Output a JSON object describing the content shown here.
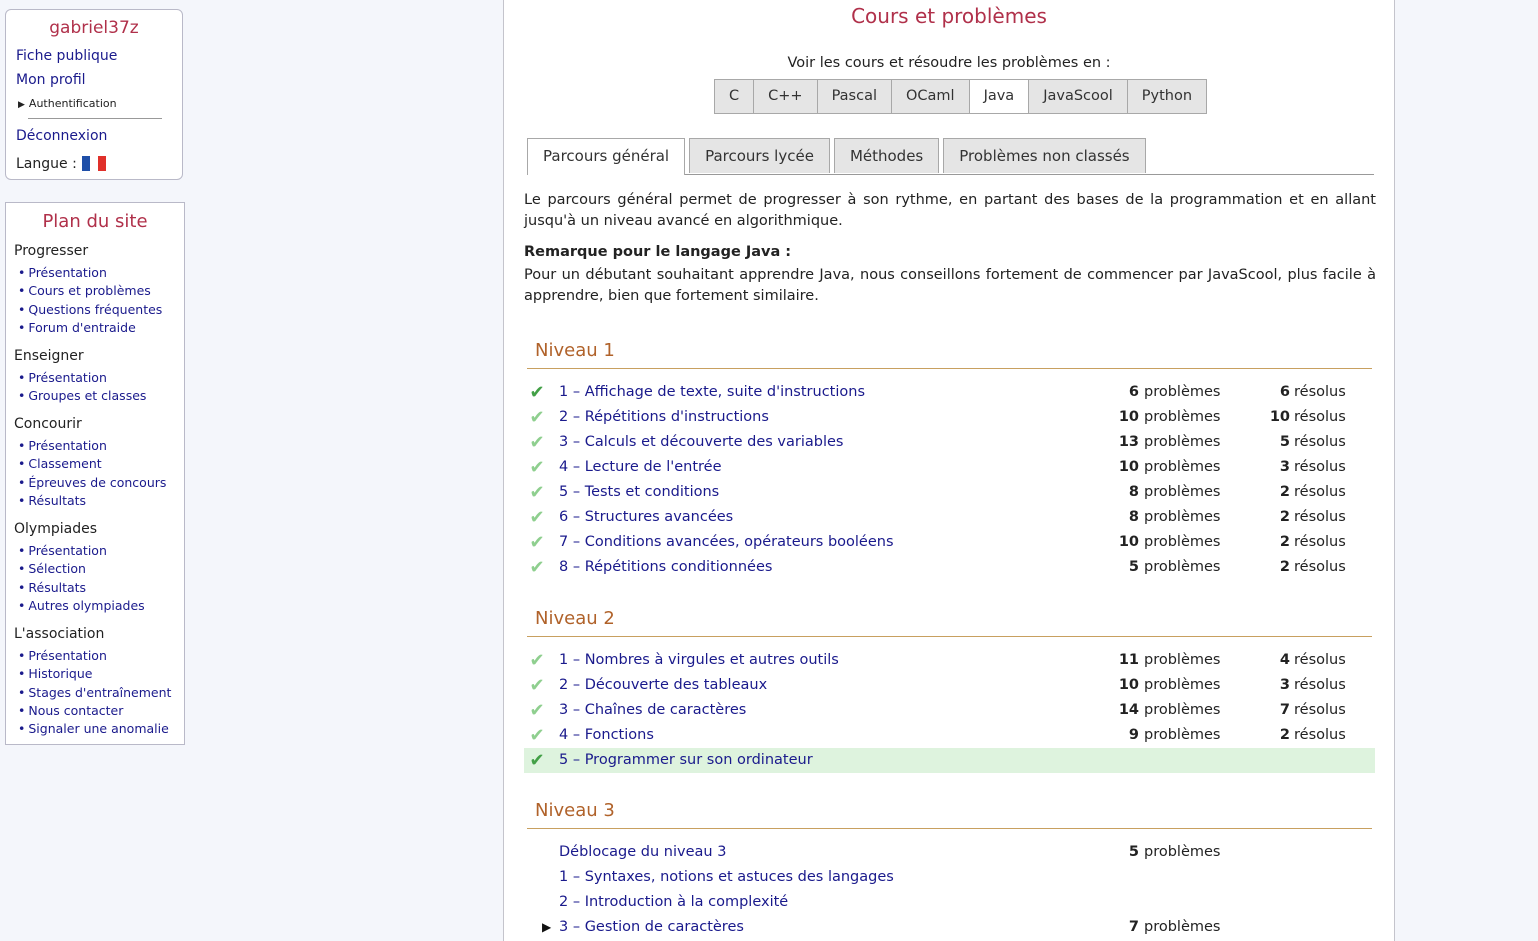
{
  "user": {
    "name": "gabriel37z",
    "links": [
      "Fiche publique",
      "Mon profil"
    ],
    "auth_label": "Authentification",
    "logout": "Déconnexion",
    "language_label": "Langue :"
  },
  "plan": {
    "title": "Plan du site",
    "sections": [
      {
        "title": "Progresser",
        "items": [
          "Présentation",
          "Cours et problèmes",
          "Questions fréquentes",
          "Forum d'entraide"
        ]
      },
      {
        "title": "Enseigner",
        "items": [
          "Présentation",
          "Groupes et classes"
        ]
      },
      {
        "title": "Concourir",
        "items": [
          "Présentation",
          "Classement",
          "Épreuves de concours",
          "Résultats"
        ]
      },
      {
        "title": "Olympiades",
        "items": [
          "Présentation",
          "Sélection",
          "Résultats",
          "Autres olympiades"
        ]
      },
      {
        "title": "L'association",
        "items": [
          "Présentation",
          "Historique",
          "Stages d'entraînement",
          "Nous contacter",
          "Signaler une anomalie"
        ]
      }
    ]
  },
  "main": {
    "title": "Cours et problèmes",
    "lang_intro": "Voir les cours et résoudre les problèmes en :",
    "languages": [
      "C",
      "C++",
      "Pascal",
      "OCaml",
      "Java",
      "JavaScool",
      "Python"
    ],
    "active_language": "Java",
    "tabs": [
      "Parcours général",
      "Parcours lycée",
      "Méthodes",
      "Problèmes non classés"
    ],
    "active_tab": "Parcours général",
    "intro": "Le parcours général permet de progresser à son rythme, en partant des bases de la programmation et en allant jusqu'à un niveau avancé en algorithmique.",
    "remark_title": "Remarque pour le langage Java :",
    "remark_text": "Pour un débutant souhaitant apprendre Java, nous conseillons fortement de commencer par JavaScool, plus facile à apprendre, bien que fortement similaire.",
    "problems_label": "problèmes",
    "solved_label": "résolus",
    "levels": [
      {
        "title": "Niveau 1",
        "rows": [
          {
            "title": "1 – Affichage de texte, suite d'instructions",
            "problems": "6",
            "solved": "6",
            "check": "full"
          },
          {
            "title": "2 – Répétitions d'instructions",
            "problems": "10",
            "solved": "10",
            "check": "faded"
          },
          {
            "title": "3 – Calculs et découverte des variables",
            "problems": "13",
            "solved": "5",
            "check": "faded"
          },
          {
            "title": "4 – Lecture de l'entrée",
            "problems": "10",
            "solved": "3",
            "check": "faded"
          },
          {
            "title": "5 – Tests et conditions",
            "problems": "8",
            "solved": "2",
            "check": "faded"
          },
          {
            "title": "6 – Structures avancées",
            "problems": "8",
            "solved": "2",
            "check": "faded"
          },
          {
            "title": "7 – Conditions avancées, opérateurs booléens",
            "problems": "10",
            "solved": "2",
            "check": "faded"
          },
          {
            "title": "8 – Répétitions conditionnées",
            "problems": "5",
            "solved": "2",
            "check": "faded"
          }
        ]
      },
      {
        "title": "Niveau 2",
        "rows": [
          {
            "title": "1 – Nombres à virgules et autres outils",
            "problems": "11",
            "solved": "4",
            "check": "faded"
          },
          {
            "title": "2 – Découverte des tableaux",
            "problems": "10",
            "solved": "3",
            "check": "faded"
          },
          {
            "title": "3 – Chaînes de caractères",
            "problems": "14",
            "solved": "7",
            "check": "faded"
          },
          {
            "title": "4 – Fonctions",
            "problems": "9",
            "solved": "2",
            "check": "faded"
          },
          {
            "title": "5 – Programmer sur son ordinateur",
            "problems": "",
            "solved": "",
            "check": "full",
            "highlight": true
          }
        ]
      },
      {
        "title": "Niveau 3",
        "rows": [
          {
            "title": "Déblocage du niveau 3",
            "problems": "5",
            "solved": "",
            "check": "none"
          },
          {
            "title": "1 – Syntaxes, notions et astuces des langages",
            "problems": "",
            "solved": "",
            "check": "none"
          },
          {
            "title": "2 – Introduction à la complexité",
            "problems": "",
            "solved": "",
            "check": "none"
          },
          {
            "title": "3 – Gestion de caractères",
            "problems": "7",
            "solved": "",
            "check": "none",
            "marker": true
          }
        ]
      }
    ]
  },
  "colors": {
    "accent_red": "#b0304a",
    "level_orange": "#b0622a",
    "link_blue": "#1a1a8c",
    "check_green": "#43a047",
    "highlight_green": "#def3de"
  },
  "icons": {
    "check": "check-icon",
    "flag": "flag-fr-icon",
    "triangle": "triangle-right-icon"
  }
}
